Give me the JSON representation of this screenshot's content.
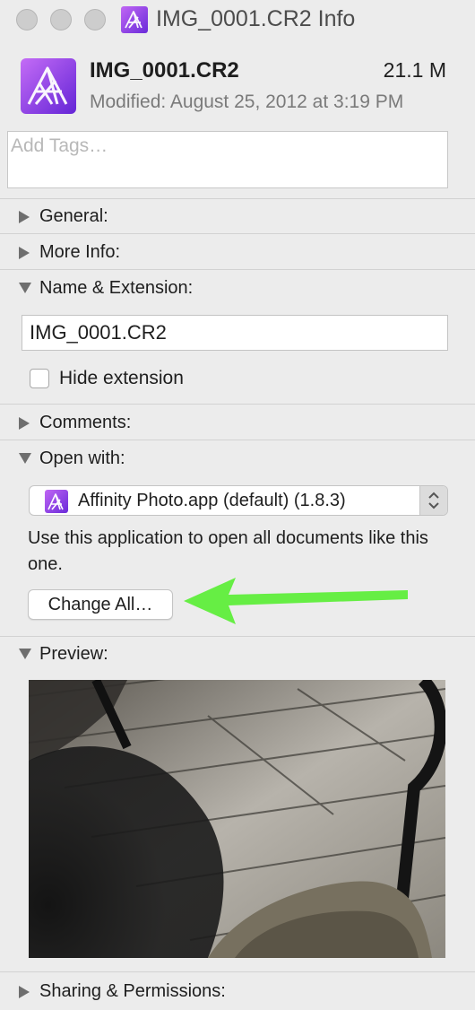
{
  "window": {
    "title": "IMG_0001.CR2 Info"
  },
  "header": {
    "file_name": "IMG_0001.CR2",
    "file_size": "21.1 M",
    "modified": "Modified: August 25, 2012 at 3:19 PM",
    "icon": "affinity-photo-icon"
  },
  "tags": {
    "placeholder": "Add Tags…"
  },
  "sections": {
    "general": "General:",
    "more_info": "More Info:",
    "name_extension": "Name & Extension:",
    "comments": "Comments:",
    "open_with": "Open with:",
    "preview": "Preview:",
    "sharing": "Sharing & Permissions:"
  },
  "name_extension": {
    "value": "IMG_0001.CR2",
    "hide_extension_label": "Hide extension",
    "hide_extension_checked": false
  },
  "open_with": {
    "app": "Affinity Photo.app (default)  (1.8.3)",
    "app_icon": "affinity-photo-icon",
    "description": "Use this application to open all documents like this one.",
    "change_all_label": "Change All…"
  },
  "annotation": {
    "arrow_color": "#66ee44"
  },
  "colors": {
    "window_bg": "#ececec",
    "affinity_purple": "#8e3fe8"
  }
}
